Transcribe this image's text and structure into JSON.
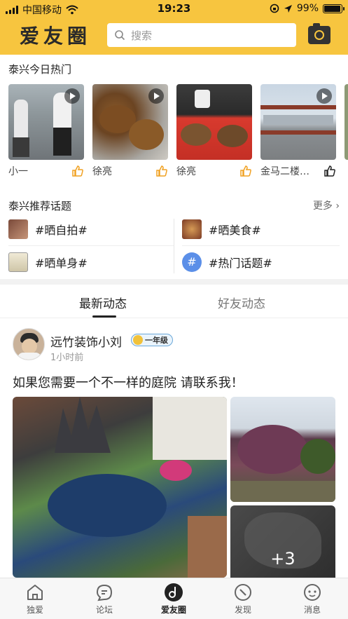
{
  "status": {
    "carrier": "中国移动",
    "time": "19:23",
    "battery": "99%"
  },
  "header": {
    "logo": "爱友圈",
    "search_placeholder": "搜索",
    "camera_icon": "camera-icon"
  },
  "hot": {
    "title": "泰兴今日热门",
    "items": [
      {
        "name": "小一",
        "video": true
      },
      {
        "name": "徐亮",
        "video": true
      },
      {
        "name": "徐亮",
        "video": false
      },
      {
        "name": "金马二楼…",
        "video": true
      }
    ]
  },
  "topics": {
    "title": "泰兴推荐话题",
    "more": "更多",
    "items": [
      "#晒自拍#",
      "#晒美食#",
      "#晒单身#",
      "#热门话题#"
    ]
  },
  "tabs": {
    "latest": "最新动态",
    "friends": "好友动态"
  },
  "post": {
    "author": "远竹装饰小刘",
    "badge": "一年级",
    "time": "1小时前",
    "text": "如果您需要一个不一样的庭院 请联系我！",
    "more_images": "+3"
  },
  "bottom_nav": [
    "独爱",
    "论坛",
    "爱友圈",
    "发现",
    "消息"
  ],
  "colors": {
    "accent": "#f7c53f",
    "like": "#f0a020",
    "topic_blue": "#5b8fe8"
  }
}
